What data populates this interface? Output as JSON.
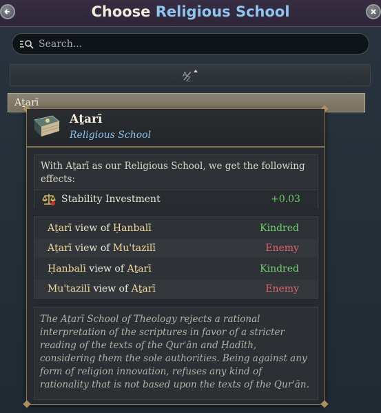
{
  "header": {
    "title_prefix": "Choose",
    "title_accent": "Religious School",
    "back_icon": "arrow-left-icon",
    "close_icon": "close-icon"
  },
  "search": {
    "placeholder": "Search...",
    "value": "",
    "icon": "search-filter-icon"
  },
  "sort": {
    "icon": "sort-az-ascending-icon"
  },
  "list": {
    "selected_item": "Aṯarī"
  },
  "tooltip": {
    "name": "Aṯarī",
    "subtitle": "Religious School",
    "effects_intro": "With Aṯarī as our Religious School, we get the following effects:",
    "effects": [
      {
        "icon": "scales-icon",
        "label": "Stability Investment",
        "value": "+0.03"
      }
    ],
    "relations": [
      {
        "subject": "Aṯarī",
        "view_of": "view of",
        "object": "Ḥanbalī",
        "status": "Kindred"
      },
      {
        "subject": "Aṯarī",
        "view_of": "view of",
        "object": "Mu'tazilī",
        "status": "Enemy"
      },
      {
        "subject": "Ḥanbalī",
        "view_of": "view of",
        "object": "Aṯarī",
        "status": "Kindred"
      },
      {
        "subject": "Mu'tazilī",
        "view_of": "view of",
        "object": "Aṯarī",
        "status": "Enemy"
      }
    ],
    "description": "The Aṯarī School of Theology rejects a rational interpretation of the scriptures in favor of a stricter reading of the texts of the Qur'ān and Ḥadīth, considering them the sole authorities. Being against any form of religion innovation, refuses any kind of rationality that is not based upon the texts of the Qur'ān."
  },
  "colors": {
    "accent_blue": "#8fc5ee",
    "kindred_green": "#6fd06a",
    "enemy_red": "#e0646a",
    "gold_border": "#8a7550"
  }
}
